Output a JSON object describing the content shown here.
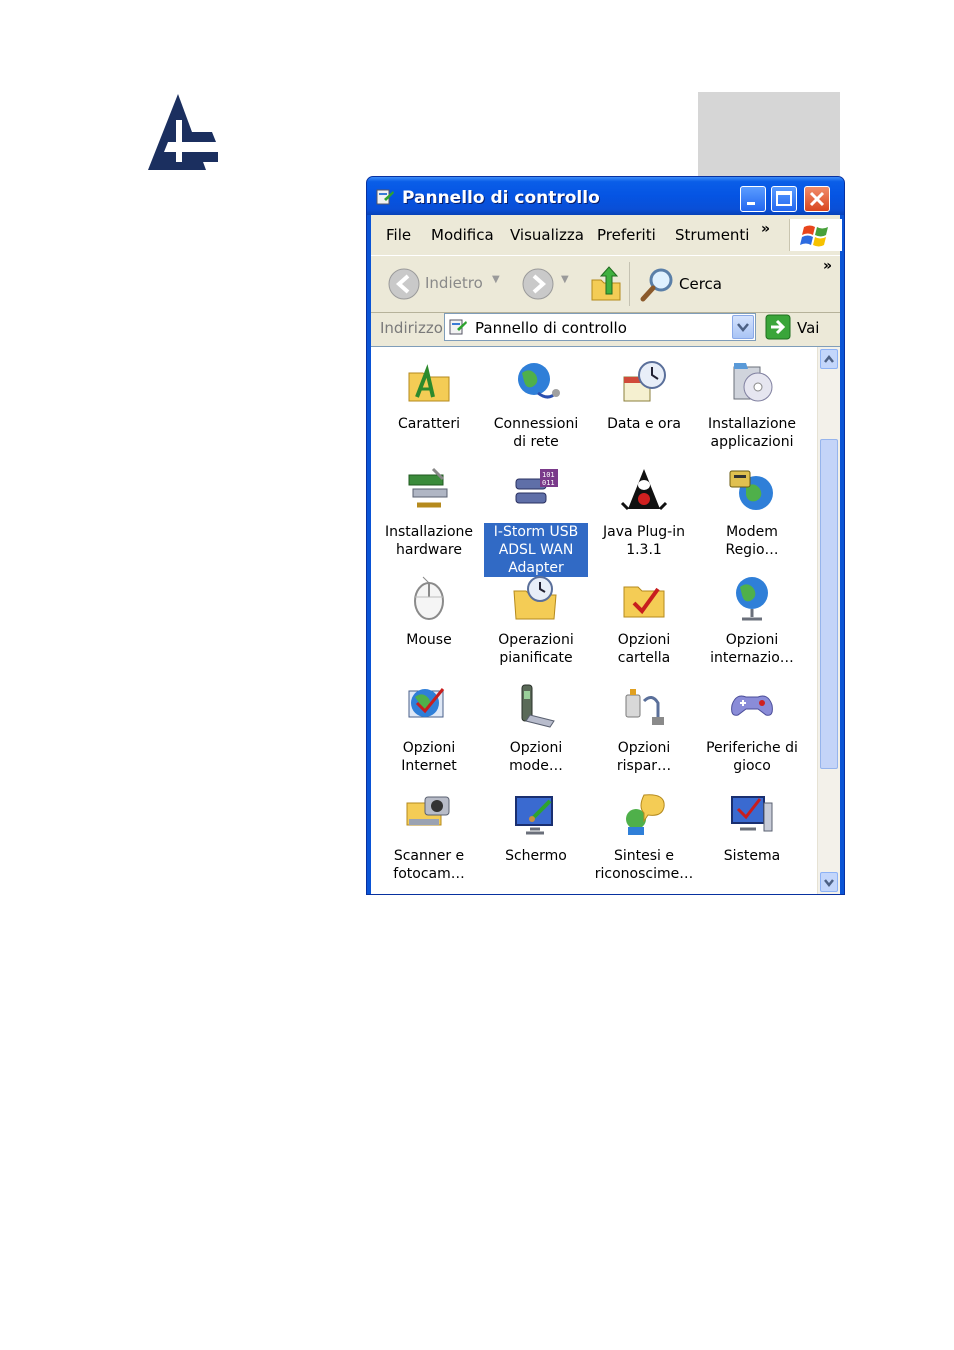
{
  "window": {
    "title": "Pannello di controllo",
    "menu": [
      "File",
      "Modifica",
      "Visualizza",
      "Preferiti",
      "Strumenti"
    ],
    "menu_more": "»",
    "toolbar": {
      "back": "Indietro",
      "search": "Cerca",
      "more": "»"
    },
    "address": {
      "label": "Indirizzo",
      "value": "Pannello di controllo",
      "go": "Vai"
    }
  },
  "items": [
    {
      "label": "Caratteri",
      "icon": "folder-fonts-icon"
    },
    {
      "label": "Connessioni di rete",
      "icon": "network-connections-icon"
    },
    {
      "label": "Data e ora",
      "icon": "date-time-icon"
    },
    {
      "label": "Installazione applicazioni",
      "icon": "add-remove-programs-icon"
    },
    {
      "label": "Installazione hardware",
      "icon": "add-hardware-icon"
    },
    {
      "label": "I-Storm USB ADSL WAN Adapter",
      "icon": "adsl-adapter-icon",
      "selected": true
    },
    {
      "label": "Java Plug-in 1.3.1",
      "icon": "java-plugin-icon"
    },
    {
      "label": "Modem Regio…",
      "icon": "phone-modem-icon"
    },
    {
      "label": "Mouse",
      "icon": "mouse-icon"
    },
    {
      "label": "Operazioni pianificate",
      "icon": "scheduled-tasks-icon"
    },
    {
      "label": "Opzioni cartella",
      "icon": "folder-options-icon"
    },
    {
      "label": "Opzioni internazio…",
      "icon": "regional-options-icon"
    },
    {
      "label": "Opzioni Internet",
      "icon": "internet-options-icon"
    },
    {
      "label": "Opzioni mode…",
      "icon": "modem-options-icon"
    },
    {
      "label": "Opzioni rispar…",
      "icon": "power-options-icon"
    },
    {
      "label": "Periferiche di gioco",
      "icon": "game-controllers-icon"
    },
    {
      "label": "Scanner e fotocam…",
      "icon": "scanners-cameras-icon"
    },
    {
      "label": "Schermo",
      "icon": "display-icon"
    },
    {
      "label": "Sintesi e riconoscime…",
      "icon": "speech-icon"
    },
    {
      "label": "Sistema",
      "icon": "system-icon"
    }
  ],
  "colors": {
    "titlebar": "#0554e3",
    "selection": "#316ac5",
    "chrome": "#ece9d8"
  }
}
